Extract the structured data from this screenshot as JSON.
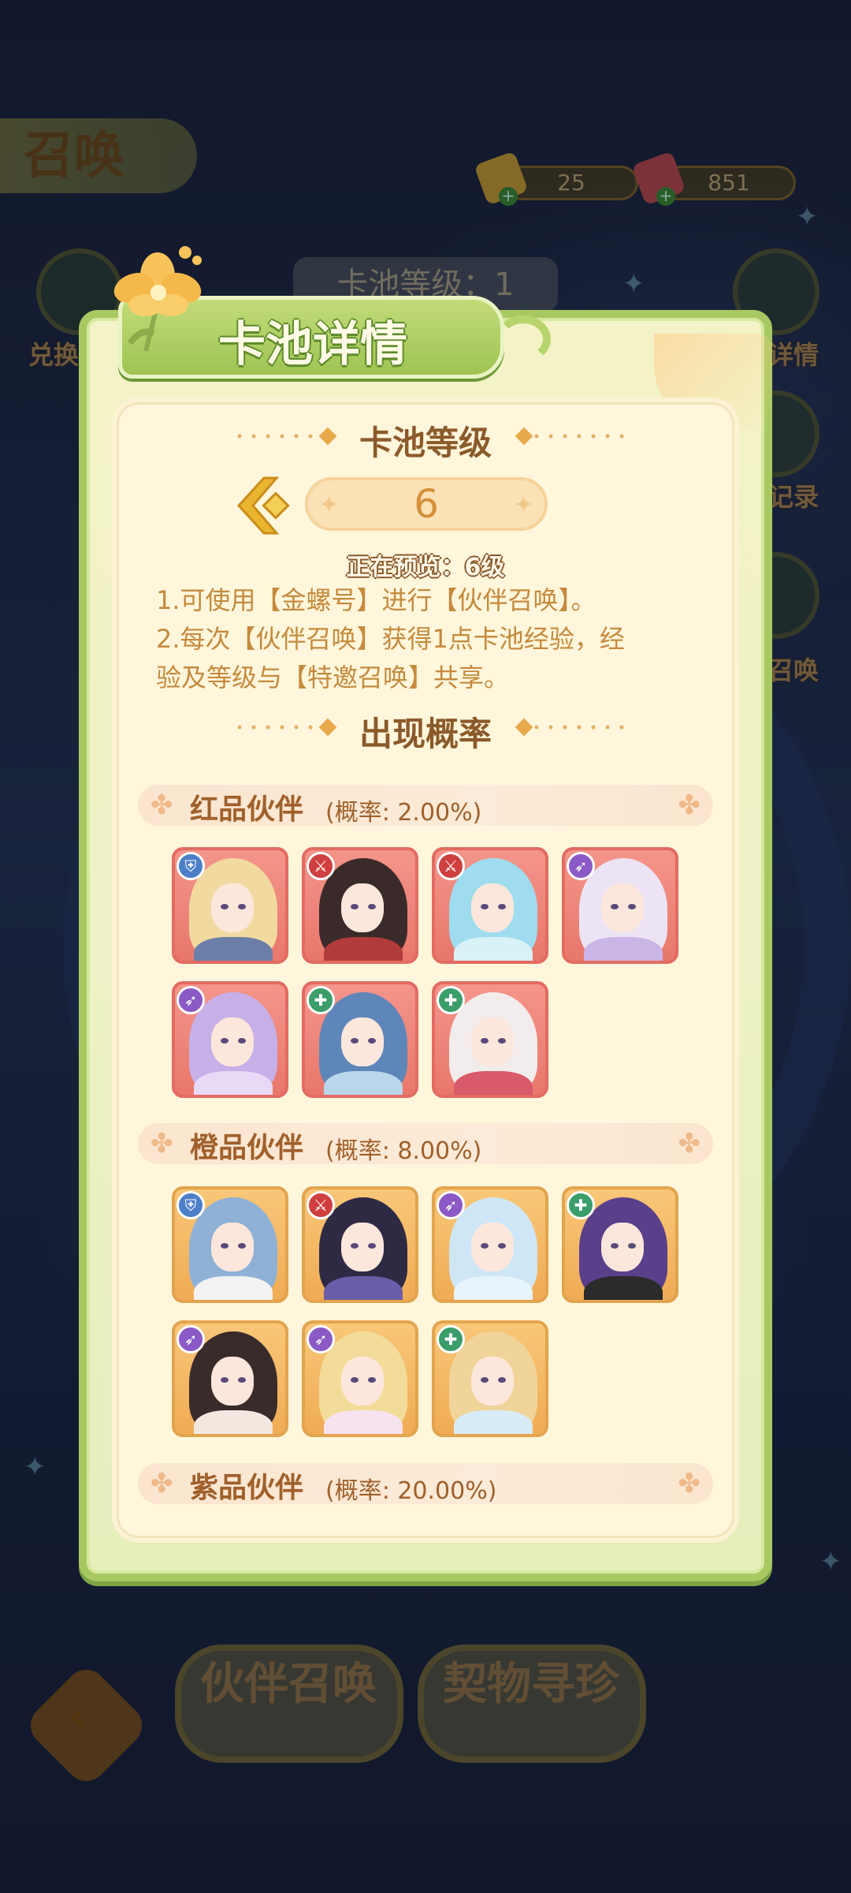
{
  "background": {
    "title": "召唤",
    "title_small": "唤",
    "currency_1": "25",
    "currency_2": "851",
    "pool_level_pill": "卡池等级：1",
    "left_button_label": "兑换",
    "right_labels": [
      "详情",
      "记录",
      "召唤"
    ],
    "bottom_buttons": [
      "伙伴召唤",
      "契物寻珍"
    ]
  },
  "dialog": {
    "title": "卡池详情",
    "level_section_title": "卡池等级",
    "level_value": "6",
    "preview_text": "正在预览：6级",
    "description": [
      "1.可使用【金螺号】进行【伙伴召唤】。",
      "2.每次【伙伴召唤】获得1点卡池经验，经",
      "验及等级与【特邀召唤】共享。"
    ],
    "rate_section_title": "出现概率",
    "tiers": [
      {
        "name": "红品伙伴",
        "rate": "(概率: 2.00%)",
        "cards": [
          "shield",
          "sword",
          "sword",
          "bow",
          "bow",
          "heal",
          "heal"
        ]
      },
      {
        "name": "橙品伙伴",
        "rate": "(概率: 8.00%)",
        "cards": [
          "shield",
          "sword",
          "bow",
          "heal",
          "bow",
          "bow",
          "heal"
        ]
      },
      {
        "name": "紫品伙伴",
        "rate": "(概率: 20.00%)",
        "cards": []
      }
    ]
  },
  "colors": {
    "dialog_border": "#a8c962",
    "panel_bg": "#fff6dc",
    "title_brown": "#8b5a2a",
    "red_tier": "#e36b62",
    "orange_tier": "#e2a44e"
  },
  "icons": {
    "shield": "shield-icon",
    "sword": "sword-icon",
    "bow": "bow-icon",
    "heal": "heal-icon"
  }
}
